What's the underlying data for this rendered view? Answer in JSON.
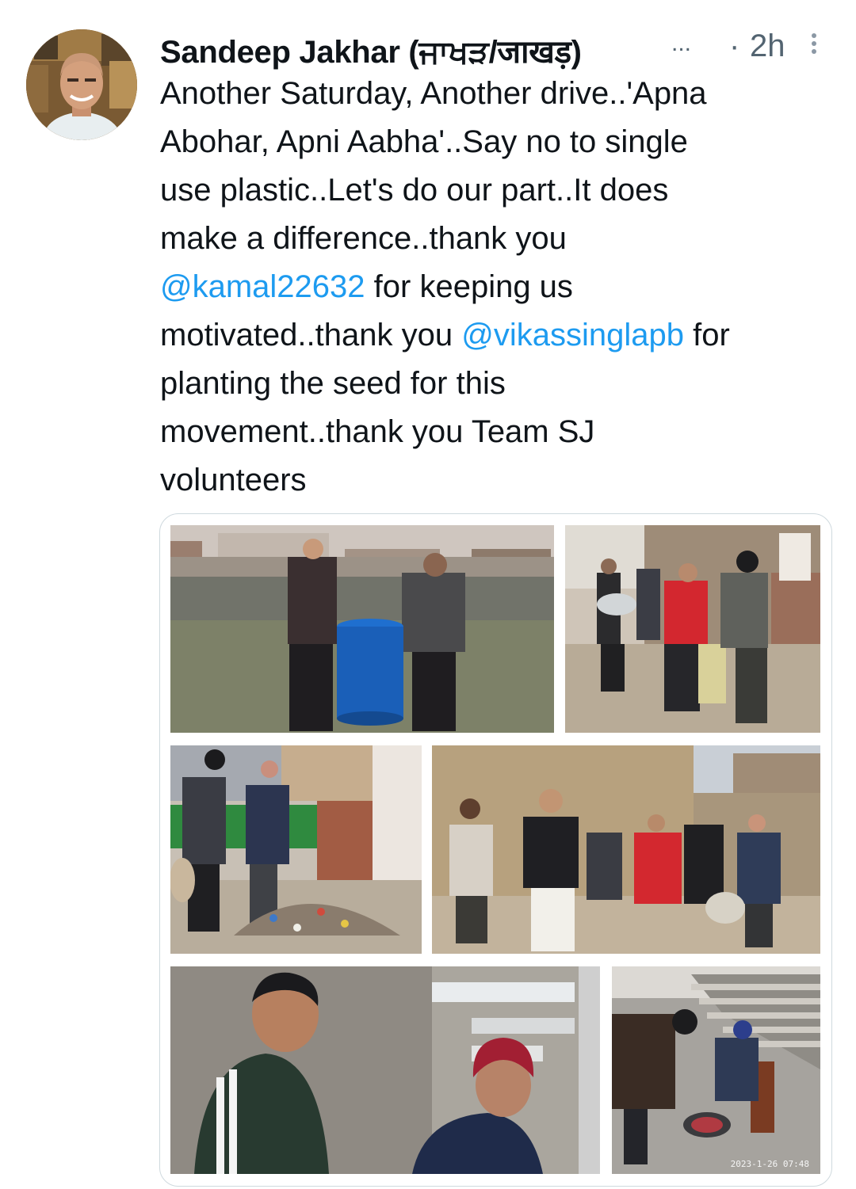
{
  "tweet": {
    "author_name": "Sandeep Jakhar (ਜਾਖੜ/जाखड़)",
    "name_truncation": "...",
    "separator": "·",
    "time": "2h",
    "text_lines": [
      {
        "parts": [
          {
            "text": "Another Saturday, Another drive..'Apna",
            "type": "text"
          }
        ]
      },
      {
        "parts": [
          {
            "text": "Abohar, Apni Aabha'..Say no to single",
            "type": "text"
          }
        ]
      },
      {
        "parts": [
          {
            "text": "use plastic..Let's do our part..It does",
            "type": "text"
          }
        ]
      },
      {
        "parts": [
          {
            "text": "make a difference..thank you",
            "type": "text"
          }
        ]
      },
      {
        "parts": [
          {
            "text": "@kamal22632",
            "type": "mention"
          },
          {
            "text": " for keeping us",
            "type": "text"
          }
        ]
      },
      {
        "parts": [
          {
            "text": "motivated..thank you ",
            "type": "text"
          },
          {
            "text": "@vikassinglapb",
            "type": "mention"
          },
          {
            "text": " for",
            "type": "text"
          }
        ]
      },
      {
        "parts": [
          {
            "text": "planting the seed for this",
            "type": "text"
          }
        ]
      },
      {
        "parts": [
          {
            "text": "movement..thank you Team SJ",
            "type": "text"
          }
        ]
      },
      {
        "parts": [
          {
            "text": "volunteers",
            "type": "text"
          }
        ]
      }
    ]
  },
  "media": {
    "photos": [
      {
        "name": "photo-two-men-carrying-blue-drum"
      },
      {
        "name": "photo-volunteers-collecting-waste-by-wall"
      },
      {
        "name": "photo-two-men-with-waste-pile"
      },
      {
        "name": "photo-group-of-volunteers"
      },
      {
        "name": "photo-selfie-with-boy"
      },
      {
        "name": "photo-cleaning-stadium-steps",
        "timestamp": "2023-1-26 07:48"
      }
    ]
  },
  "colors": {
    "mention": "#1d9bf0",
    "text": "#0f1419",
    "secondary": "#536471",
    "card_border": "#cfd9de"
  },
  "icons": {
    "more": "more-vertical-icon"
  }
}
